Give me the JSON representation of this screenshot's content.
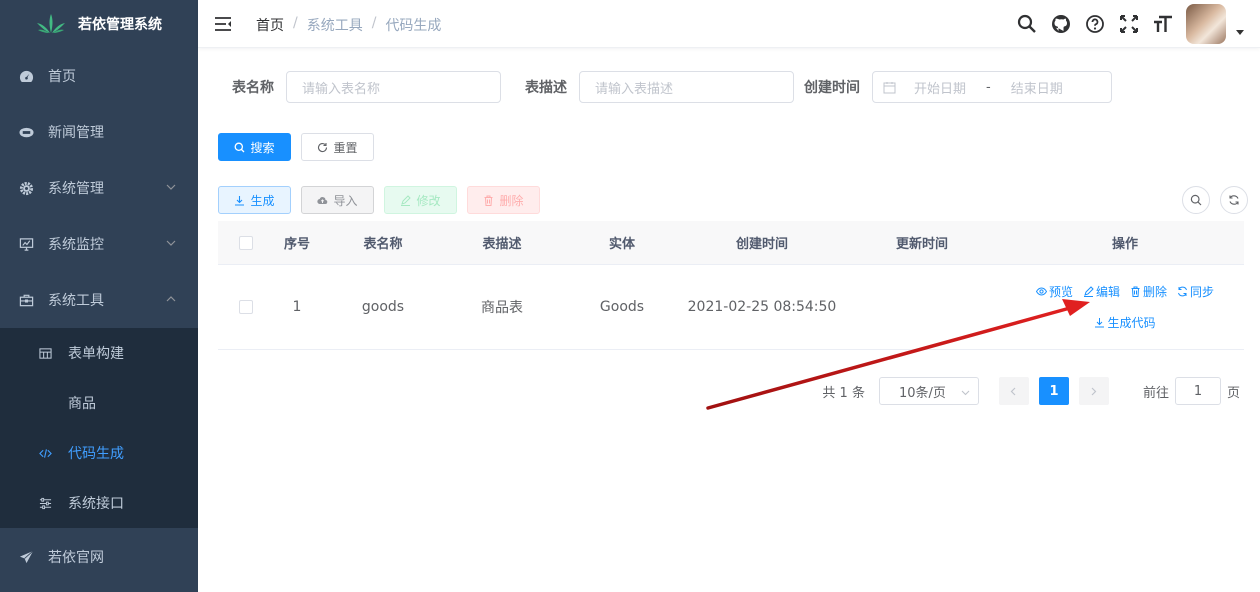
{
  "app": {
    "title": "若依管理系统"
  },
  "sidebar": {
    "items": [
      {
        "label": "首页",
        "icon": "dashboard-icon"
      },
      {
        "label": "新闻管理",
        "icon": "news-icon"
      },
      {
        "label": "系统管理",
        "icon": "gear-icon"
      },
      {
        "label": "系统监控",
        "icon": "monitor-icon"
      },
      {
        "label": "系统工具",
        "icon": "toolbox-icon"
      }
    ],
    "sub_items": [
      {
        "label": "表单构建",
        "icon": "form-icon"
      },
      {
        "label": "商品"
      },
      {
        "label": "代码生成",
        "icon": "code-icon",
        "active": true
      },
      {
        "label": "系统接口",
        "icon": "sliders-icon"
      }
    ],
    "footer_item": {
      "label": "若依官网",
      "icon": "send-icon"
    }
  },
  "header": {
    "breadcrumb": [
      "首页",
      "系统工具",
      "代码生成"
    ],
    "icons": [
      "search-icon",
      "github-icon",
      "question-icon",
      "fullscreen-icon",
      "font-size-icon"
    ]
  },
  "search_form": {
    "table_name_label": "表名称",
    "table_name_placeholder": "请输入表名称",
    "table_desc_label": "表描述",
    "table_desc_placeholder": "请输入表描述",
    "create_time_label": "创建时间",
    "start_placeholder": "开始日期",
    "range_sep": "-",
    "end_placeholder": "结束日期",
    "search_label": "搜索",
    "reset_label": "重置"
  },
  "toolbar": {
    "generate_label": "生成",
    "import_label": "导入",
    "edit_label": "修改",
    "delete_label": "删除"
  },
  "table": {
    "columns": [
      "序号",
      "表名称",
      "表描述",
      "实体",
      "创建时间",
      "更新时间",
      "操作"
    ],
    "rows": [
      {
        "index": "1",
        "name": "goods",
        "desc": "商品表",
        "entity": "Goods",
        "created": "2021-02-25 08:54:50",
        "updated": "",
        "ops": {
          "preview": "预览",
          "edit": "编辑",
          "delete": "删除",
          "sync": "同步",
          "gen": "生成代码"
        }
      }
    ]
  },
  "pagination": {
    "total": "共 1 条",
    "page_size": "10条/页",
    "current": "1",
    "goto_label": "前往",
    "goto_value": "1",
    "page_unit": "页"
  },
  "colors": {
    "sidebar_bg": "#304156",
    "primary": "#1890ff",
    "annotation_arrow": "#d42020"
  }
}
